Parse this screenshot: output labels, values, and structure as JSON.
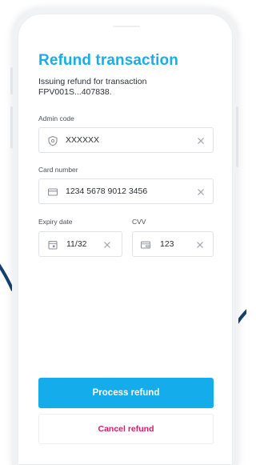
{
  "page": {
    "title": "Refund transaction",
    "subtitle": "Issuing refund for transaction FPV001S...407838."
  },
  "fields": {
    "admin_code": {
      "label": "Admin code",
      "value": "XXXXXX",
      "icon": "shield-icon"
    },
    "card_number": {
      "label": "Card number",
      "value": "1234 5678 9012 3456",
      "icon": "credit-card-icon"
    },
    "expiry_date": {
      "label": "Expiry date",
      "value": "11/32",
      "icon": "calendar-icon"
    },
    "cvv": {
      "label": "CVV",
      "value": "123",
      "icon": "card-back-icon"
    }
  },
  "actions": {
    "primary_label": "Process refund",
    "secondary_label": "Cancel refund"
  },
  "colors": {
    "accent": "#14acea",
    "danger": "#d81b60",
    "decor_curve": "#16406f"
  }
}
